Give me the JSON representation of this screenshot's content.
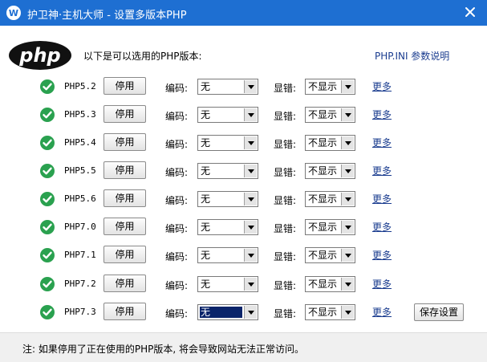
{
  "window": {
    "title": "护卫神·主机大师 - 设置多版本PHP",
    "title_bar_color": "#1e6fd2",
    "app_icon": "shield-w-icon",
    "close_icon": "close-icon"
  },
  "header": {
    "logo_text": "php",
    "intro": "以下是可以选用的PHP版本:",
    "ini_link": "PHP.INI 参数说明"
  },
  "labels": {
    "encoding": "编码:",
    "display_errors": "显错:"
  },
  "versions": [
    {
      "version": "PHP5.2",
      "stop_label": "停用",
      "encoding": "无",
      "display_errors": "不显示",
      "more": "更多"
    },
    {
      "version": "PHP5.3",
      "stop_label": "停用",
      "encoding": "无",
      "display_errors": "不显示",
      "more": "更多"
    },
    {
      "version": "PHP5.4",
      "stop_label": "停用",
      "encoding": "无",
      "display_errors": "不显示",
      "more": "更多"
    },
    {
      "version": "PHP5.5",
      "stop_label": "停用",
      "encoding": "无",
      "display_errors": "不显示",
      "more": "更多"
    },
    {
      "version": "PHP5.6",
      "stop_label": "停用",
      "encoding": "无",
      "display_errors": "不显示",
      "more": "更多"
    },
    {
      "version": "PHP7.0",
      "stop_label": "停用",
      "encoding": "无",
      "display_errors": "不显示",
      "more": "更多"
    },
    {
      "version": "PHP7.1",
      "stop_label": "停用",
      "encoding": "无",
      "display_errors": "不显示",
      "more": "更多"
    },
    {
      "version": "PHP7.2",
      "stop_label": "停用",
      "encoding": "无",
      "display_errors": "不显示",
      "more": "更多"
    },
    {
      "version": "PHP7.3",
      "stop_label": "停用",
      "encoding": "无",
      "display_errors": "不显示",
      "more": "更多"
    }
  ],
  "status_icon": "check-circle-icon",
  "status_color": "#2aa14f",
  "link_color": "#1a3c8f",
  "save_button": "保存设置",
  "footer_note": "注: 如果停用了正在使用的PHP版本, 将会导致网站无法正常访问。"
}
